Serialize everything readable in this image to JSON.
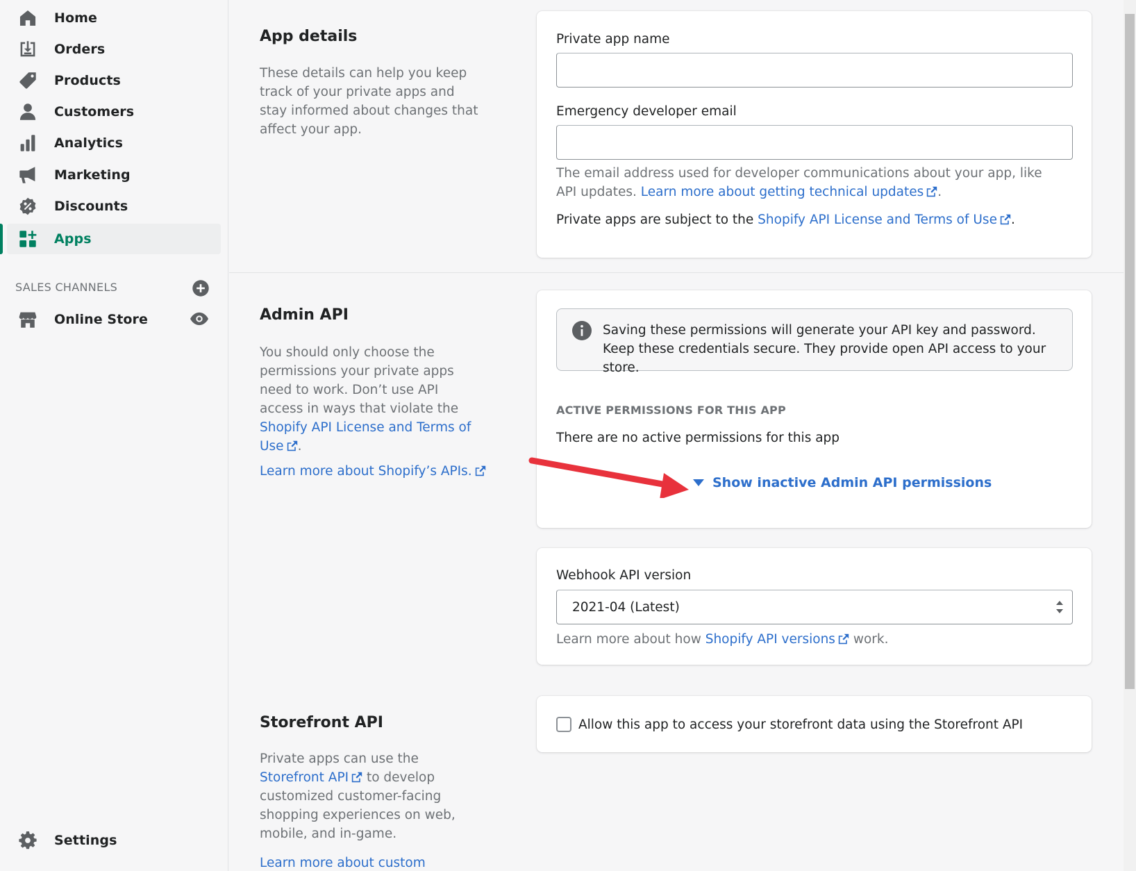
{
  "sidebar": {
    "items": [
      {
        "label": "Home",
        "icon": "home-icon"
      },
      {
        "label": "Orders",
        "icon": "orders-icon"
      },
      {
        "label": "Products",
        "icon": "tag-icon"
      },
      {
        "label": "Customers",
        "icon": "person-icon"
      },
      {
        "label": "Analytics",
        "icon": "bar-chart-icon"
      },
      {
        "label": "Marketing",
        "icon": "megaphone-icon"
      },
      {
        "label": "Discounts",
        "icon": "discount-icon"
      },
      {
        "label": "Apps",
        "icon": "apps-icon",
        "active": true
      }
    ],
    "sales_channels_heading": "SALES CHANNELS",
    "online_store_label": "Online Store",
    "settings_label": "Settings"
  },
  "app_details": {
    "title": "App details",
    "description": "These details can help you keep track of your private apps and stay informed about changes that affect your app.",
    "name_label": "Private app name",
    "name_value": "",
    "email_label": "Emergency developer email",
    "email_value": "",
    "email_help": "The email address used for developer communications about your app, like API updates.",
    "email_help_link": "Learn more about getting technical updates",
    "terms_prefix": "Private apps are subject to the",
    "terms_link": "Shopify API License and Terms of Use",
    "period": "."
  },
  "admin_api": {
    "title": "Admin API",
    "description_prefix": "You should only choose the permissions your private apps need to work. Don’t use API access in ways that violate the",
    "description_link": "Shopify API License and Terms of Use",
    "learn_more_link": "Learn more about Shopify’s APIs.",
    "banner_text": "Saving these permissions will generate your API key and password. Keep these credentials secure. They provide open API access to your store.",
    "active_heading": "ACTIVE PERMISSIONS FOR THIS APP",
    "no_permissions": "There are no active permissions for this app",
    "show_inactive": "Show inactive Admin API permissions"
  },
  "webhook": {
    "label": "Webhook API version",
    "selected": "2021-04 (Latest)",
    "help_prefix": "Learn more about how",
    "help_link": "Shopify API versions",
    "help_suffix": "work."
  },
  "storefront_api": {
    "title": "Storefront API",
    "description_prefix": "Private apps can use the",
    "description_link": "Storefront API",
    "description_suffix": "to develop customized customer-facing shopping experiences on web, mobile, and in-game.",
    "learn_more_link": "Learn more about custom",
    "checkbox_label": "Allow this app to access your storefront data using the Storefront API",
    "checkbox_checked": false
  },
  "colors": {
    "accent": "#008060",
    "link": "#2c6ecb",
    "annotation_arrow": "#e8323c"
  }
}
